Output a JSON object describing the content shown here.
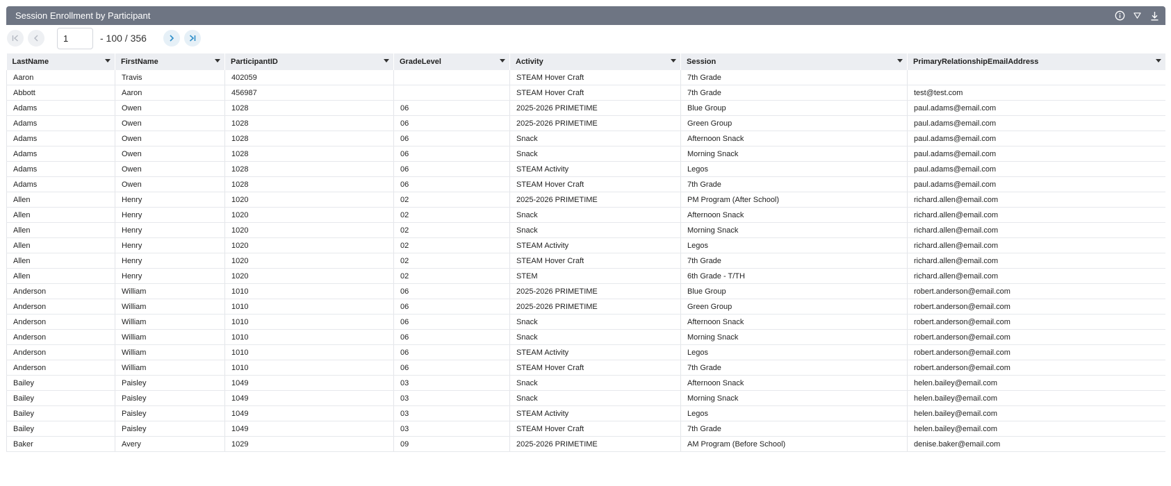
{
  "header": {
    "title": "Session Enrollment by Participant",
    "icons": [
      "info-icon",
      "filter-icon",
      "download-icon"
    ]
  },
  "pager": {
    "page": "1",
    "range": "- 100 / 356"
  },
  "table": {
    "columns": [
      "LastName",
      "FirstName",
      "ParticipantID",
      "GradeLevel",
      "Activity",
      "Session",
      "PrimaryRelationshipEmailAddress"
    ],
    "rows": [
      [
        "Aaron",
        "Travis",
        "402059",
        "",
        "STEAM Hover Craft",
        "7th Grade",
        ""
      ],
      [
        "Abbott",
        "Aaron",
        "456987",
        "",
        "STEAM Hover Craft",
        "7th Grade",
        "test@test.com"
      ],
      [
        "Adams",
        "Owen",
        "1028",
        "06",
        "2025-2026 PRIMETIME",
        "Blue Group",
        "paul.adams@email.com"
      ],
      [
        "Adams",
        "Owen",
        "1028",
        "06",
        "2025-2026 PRIMETIME",
        "Green Group",
        "paul.adams@email.com"
      ],
      [
        "Adams",
        "Owen",
        "1028",
        "06",
        "Snack",
        "Afternoon Snack",
        "paul.adams@email.com"
      ],
      [
        "Adams",
        "Owen",
        "1028",
        "06",
        "Snack",
        "Morning Snack",
        "paul.adams@email.com"
      ],
      [
        "Adams",
        "Owen",
        "1028",
        "06",
        "STEAM Activity",
        "Legos",
        "paul.adams@email.com"
      ],
      [
        "Adams",
        "Owen",
        "1028",
        "06",
        "STEAM Hover Craft",
        "7th Grade",
        "paul.adams@email.com"
      ],
      [
        "Allen",
        "Henry",
        "1020",
        "02",
        "2025-2026 PRIMETIME",
        "PM Program (After School)",
        "richard.allen@email.com"
      ],
      [
        "Allen",
        "Henry",
        "1020",
        "02",
        "Snack",
        "Afternoon Snack",
        "richard.allen@email.com"
      ],
      [
        "Allen",
        "Henry",
        "1020",
        "02",
        "Snack",
        "Morning Snack",
        "richard.allen@email.com"
      ],
      [
        "Allen",
        "Henry",
        "1020",
        "02",
        "STEAM Activity",
        "Legos",
        "richard.allen@email.com"
      ],
      [
        "Allen",
        "Henry",
        "1020",
        "02",
        "STEAM Hover Craft",
        "7th Grade",
        "richard.allen@email.com"
      ],
      [
        "Allen",
        "Henry",
        "1020",
        "02",
        "STEM",
        "6th Grade - T/TH",
        "richard.allen@email.com"
      ],
      [
        "Anderson",
        "William",
        "1010",
        "06",
        "2025-2026 PRIMETIME",
        "Blue Group",
        "robert.anderson@email.com"
      ],
      [
        "Anderson",
        "William",
        "1010",
        "06",
        "2025-2026 PRIMETIME",
        "Green Group",
        "robert.anderson@email.com"
      ],
      [
        "Anderson",
        "William",
        "1010",
        "06",
        "Snack",
        "Afternoon Snack",
        "robert.anderson@email.com"
      ],
      [
        "Anderson",
        "William",
        "1010",
        "06",
        "Snack",
        "Morning Snack",
        "robert.anderson@email.com"
      ],
      [
        "Anderson",
        "William",
        "1010",
        "06",
        "STEAM Activity",
        "Legos",
        "robert.anderson@email.com"
      ],
      [
        "Anderson",
        "William",
        "1010",
        "06",
        "STEAM Hover Craft",
        "7th Grade",
        "robert.anderson@email.com"
      ],
      [
        "Bailey",
        "Paisley",
        "1049",
        "03",
        "Snack",
        "Afternoon Snack",
        "helen.bailey@email.com"
      ],
      [
        "Bailey",
        "Paisley",
        "1049",
        "03",
        "Snack",
        "Morning Snack",
        "helen.bailey@email.com"
      ],
      [
        "Bailey",
        "Paisley",
        "1049",
        "03",
        "STEAM Activity",
        "Legos",
        "helen.bailey@email.com"
      ],
      [
        "Bailey",
        "Paisley",
        "1049",
        "03",
        "STEAM Hover Craft",
        "7th Grade",
        "helen.bailey@email.com"
      ],
      [
        "Baker",
        "Avery",
        "1029",
        "09",
        "2025-2026 PRIMETIME",
        "AM Program (Before School)",
        "denise.baker@email.com"
      ]
    ]
  },
  "colors": {
    "titlebar": "#6e7583",
    "header_row": "#eceef2",
    "pager_accent": "#2f8fc9"
  }
}
